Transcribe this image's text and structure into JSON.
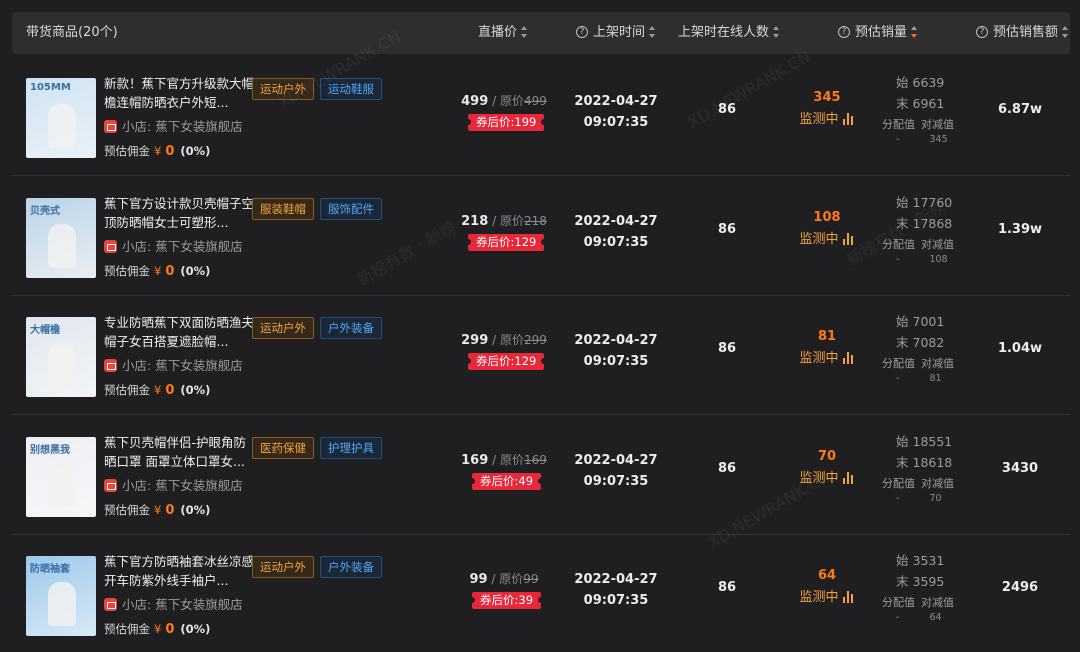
{
  "header": {
    "product_col": "带货商品(20个)",
    "price_col": "直播价",
    "time_col": "上架时间",
    "online_col": "上架时在线人数",
    "sales_col": "预估销量",
    "amount_col": "预估销售额"
  },
  "watermarks": [
    "XD.NEWRANK.CN",
    "新榜有数 · 新榜",
    "新榜有数 · 新榜",
    "XD.NEWRANK.CN"
  ],
  "labels": {
    "shop_prefix": "小店:",
    "commission": "预估佣金",
    "yen": "¥",
    "orig_prefix": "/ 原价",
    "coupon_prefix": "券后价:",
    "monitoring": "监测中",
    "start": "始",
    "end": "末",
    "alloc": "分配值",
    "reduce": "对减值",
    "dash": "-"
  },
  "colors": {
    "accent_orange": "#ff7a1a",
    "coupon_red": "#e8283a",
    "tag_orange": "#f4a23c",
    "tag_blue": "#4ea5ff"
  },
  "products": [
    {
      "title": "新款！蕉下官方升级款大帽檐连帽防晒衣户外短...",
      "tags": [
        "运动户外",
        "运动鞋服"
      ],
      "shop": "蕉下女装旗舰店",
      "commission": "0",
      "commission_pct": "(0%)",
      "price": "499",
      "orig_price": "499",
      "coupon_price": "199",
      "date": "2022-04-27",
      "time": "09:07:35",
      "online": "86",
      "sales": "345",
      "start": "6639",
      "end": "6961",
      "reduce_value": "345",
      "amount": "6.87w",
      "thumb_text": "105MM"
    },
    {
      "title": "蕉下官方设计款贝壳帽子空顶防晒帽女士可塑形...",
      "tags": [
        "服装鞋帽",
        "服饰配件"
      ],
      "shop": "蕉下女装旗舰店",
      "commission": "0",
      "commission_pct": "(0%)",
      "price": "218",
      "orig_price": "218",
      "coupon_price": "129",
      "date": "2022-04-27",
      "time": "09:07:35",
      "online": "86",
      "sales": "108",
      "start": "17760",
      "end": "17868",
      "reduce_value": "108",
      "amount": "1.39w",
      "thumb_text": "贝壳式"
    },
    {
      "title": "专业防晒蕉下双面防晒渔夫帽子女百搭夏遮脸帽...",
      "tags": [
        "运动户外",
        "户外装备"
      ],
      "shop": "蕉下女装旗舰店",
      "commission": "0",
      "commission_pct": "(0%)",
      "price": "299",
      "orig_price": "299",
      "coupon_price": "129",
      "date": "2022-04-27",
      "time": "09:07:35",
      "online": "86",
      "sales": "81",
      "start": "7001",
      "end": "7082",
      "reduce_value": "81",
      "amount": "1.04w",
      "thumb_text": "大帽檐"
    },
    {
      "title": "蕉下贝壳帽伴侣-护眼角防晒口罩 面罩立体口罩女...",
      "tags": [
        "医药保健",
        "护理护具"
      ],
      "shop": "蕉下女装旗舰店",
      "commission": "0",
      "commission_pct": "(0%)",
      "price": "169",
      "orig_price": "169",
      "coupon_price": "49",
      "date": "2022-04-27",
      "time": "09:07:35",
      "online": "86",
      "sales": "70",
      "start": "18551",
      "end": "18618",
      "reduce_value": "70",
      "amount": "3430",
      "thumb_text": "别想黑我"
    },
    {
      "title": "蕉下官方防晒袖套冰丝凉感开车防紫外线手袖户...",
      "tags": [
        "运动户外",
        "户外装备"
      ],
      "shop": "蕉下女装旗舰店",
      "commission": "0",
      "commission_pct": "(0%)",
      "price": "99",
      "orig_price": "99",
      "coupon_price": "39",
      "date": "2022-04-27",
      "time": "09:07:35",
      "online": "86",
      "sales": "64",
      "start": "3531",
      "end": "3595",
      "reduce_value": "64",
      "amount": "2496",
      "thumb_text": "防晒袖套"
    }
  ]
}
